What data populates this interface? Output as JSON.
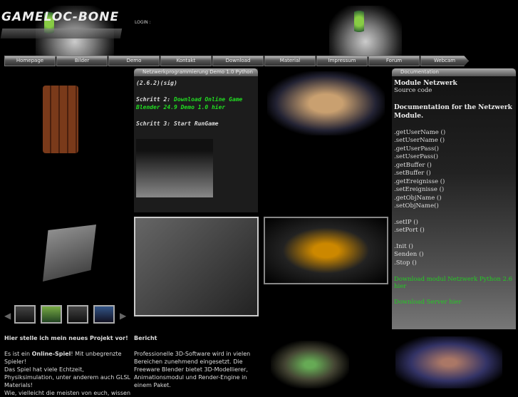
{
  "header": {
    "logo": "GAMELOC-BONE",
    "login_label": "LOGIN :"
  },
  "nav": [
    "Homepage",
    "Bilder",
    "Demo",
    "Kontakt",
    "Download",
    "Material",
    "Impressum",
    "Forum",
    "Webcam /Anleitungen"
  ],
  "demo_panel": {
    "title": "Netzwerkprogrammierung Demo 1.0 Python",
    "version": "(2.6.2)(sig)",
    "step2_label": "Schritt 2:",
    "step2_link": "Download Online Game Blender 24.9 Demo 1.0 hier",
    "step3": "Schritt 3: Start RunGame"
  },
  "doc_panel": {
    "title": "Documentation",
    "module": "Module Netzwerk",
    "source": "Source code",
    "heading": "Documentation for the Netzwerk Module.",
    "methods1": [
      ".getUserName ()",
      ".setUserName ()",
      ".getUserPass()",
      ".setUserPass()",
      ".getBuffer ()",
      ".setBuffer ()",
      ".getEreignisse ()",
      ".setEreignisse ()",
      ".getObjName ()",
      ".setObjName()"
    ],
    "methods2": [
      ".setIP ()",
      ".setPort ()"
    ],
    "methods3": [
      ".Init ()",
      "Senden ()",
      ".Stop ()"
    ],
    "link1": "Download modul Netzwerk Python 2.6 hier",
    "link2": "Download Server hier"
  },
  "intro": {
    "title": "Hier stelle ich mein neues Projekt vor!",
    "p1a": "Es ist ein ",
    "p1b": "Online-Spiel",
    "p1c": "! Mit unbegrenzte Spieler!",
    "p2": "Das Spiel hat viele Echtzeit, Physiksimulation, unter anderem auch GLSL Materials!",
    "p3": "Wie, vielleicht die meisten von euch, wissen"
  },
  "report": {
    "title": "Bericht",
    "text": "Professionelle 3D-Software wird in vielen Bereichen zunehmend eingesetzt. Die Freeware Blender bietet 3D-Modellierer, Animationsmodul und Render-Engine in einem Paket."
  }
}
